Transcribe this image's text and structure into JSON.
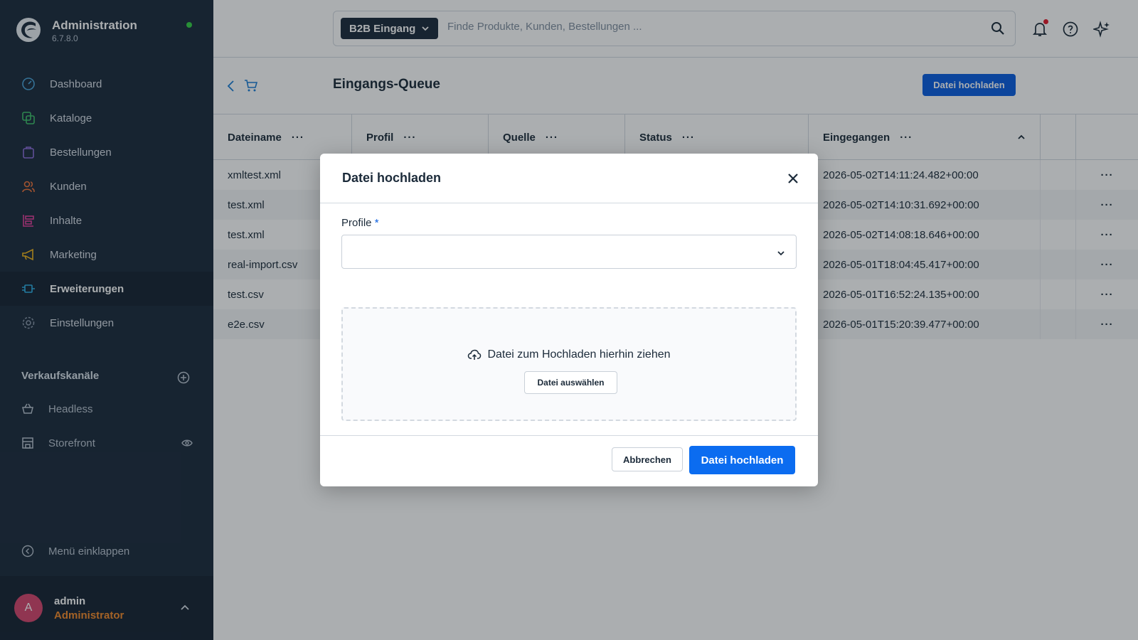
{
  "app": {
    "title": "Administration",
    "version": "6.7.8.0",
    "accent": "#0b5fe0"
  },
  "sidebar": {
    "items": [
      {
        "label": "Dashboard",
        "icon": "gauge-icon",
        "color": "#4aa4d9"
      },
      {
        "label": "Kataloge",
        "icon": "catalog-icon",
        "color": "#3fc26b"
      },
      {
        "label": "Bestellungen",
        "icon": "shopping-bag-icon",
        "color": "#8b6cd8"
      },
      {
        "label": "Kunden",
        "icon": "users-icon",
        "color": "#f0743b"
      },
      {
        "label": "Inhalte",
        "icon": "content-icon",
        "color": "#e3409c"
      },
      {
        "label": "Marketing",
        "icon": "megaphone-icon",
        "color": "#f2b51d"
      },
      {
        "label": "Erweiterungen",
        "icon": "plug-icon",
        "color": "#2fb2e8"
      },
      {
        "label": "Einstellungen",
        "icon": "gear-icon",
        "color": "#8796a8"
      }
    ],
    "active_index": 6,
    "sales_channels_title": "Verkaufskanäle",
    "sales_channels": [
      {
        "label": "Headless",
        "icon": "basket-icon"
      },
      {
        "label": "Storefront",
        "icon": "storefront-icon"
      }
    ],
    "collapse_label": "Menü einklappen",
    "user": {
      "initial": "A",
      "name": "admin",
      "role": "Administrator"
    }
  },
  "topbar": {
    "scope": "B2B Eingang",
    "search_placeholder": "Finde Produkte, Kunden, Bestellungen ..."
  },
  "page": {
    "title": "Eingangs-Queue",
    "upload_button": "Datei hochladen"
  },
  "grid": {
    "columns": [
      "Dateiname",
      "Profil",
      "Quelle",
      "Status",
      "Eingegangen"
    ],
    "rows": [
      {
        "file": "xmltest.xml",
        "received": "2026-05-02T14:11:24.482+00:00"
      },
      {
        "file": "test.xml",
        "received": "2026-05-02T14:10:31.692+00:00"
      },
      {
        "file": "test.xml",
        "received": "2026-05-02T14:08:18.646+00:00"
      },
      {
        "file": "real-import.csv",
        "received": "2026-05-01T18:04:45.417+00:00"
      },
      {
        "file": "test.csv",
        "received": "2026-05-01T16:52:24.135+00:00"
      },
      {
        "file": "e2e.csv",
        "received": "2026-05-01T15:20:39.477+00:00"
      }
    ],
    "row_menu": "···",
    "col_menu": "···"
  },
  "modal": {
    "title": "Datei hochladen",
    "profile_label": "Profile",
    "required_mark": "*",
    "profile_value": "",
    "dropzone_text": "Datei zum Hochladen hierhin ziehen",
    "choose_file": "Datei auswählen",
    "cancel": "Abbrechen",
    "submit": "Datei hochladen"
  }
}
